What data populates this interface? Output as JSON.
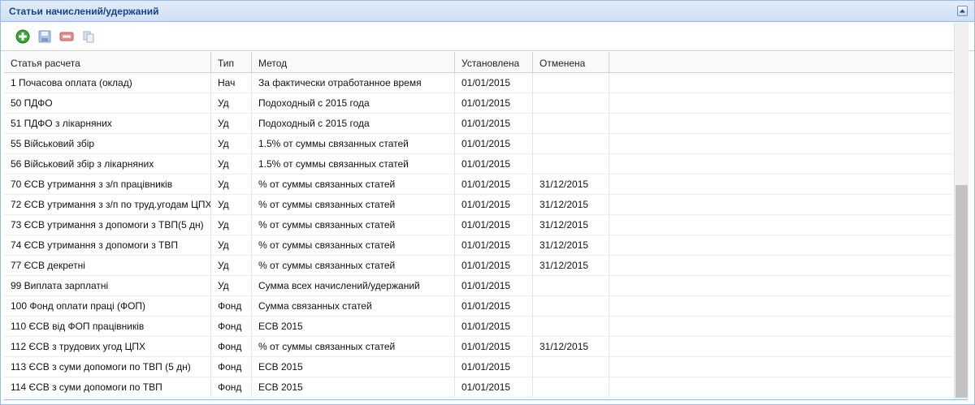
{
  "panel": {
    "title": "Статьи начислений/удержаний"
  },
  "toolbar": {
    "add_icon": "add-icon",
    "save_icon": "save-icon",
    "delete_icon": "delete-icon",
    "copy_icon": "copy-icon"
  },
  "grid": {
    "columns": [
      "Статья расчета",
      "Тип",
      "Метод",
      "Установлена",
      "Отменена"
    ],
    "rows": [
      [
        "1 Почасова оплата (оклад)",
        "Нач",
        "За фактически отработанное время",
        "01/01/2015",
        ""
      ],
      [
        "50 ПДФО",
        "Уд",
        "Подоходный с 2015 года",
        "01/01/2015",
        ""
      ],
      [
        "51 ПДФО з лікарняних",
        "Уд",
        "Подоходный с 2015 года",
        "01/01/2015",
        ""
      ],
      [
        "55 Військовий збір",
        "Уд",
        "1.5% от суммы связанных статей",
        "01/01/2015",
        ""
      ],
      [
        "56 Військовий збір з лікарняних",
        "Уд",
        "1.5% от суммы связанных статей",
        "01/01/2015",
        ""
      ],
      [
        "70 ЄСВ утримання з з/п працівників",
        "Уд",
        "% от суммы связанных статей",
        "01/01/2015",
        "31/12/2015"
      ],
      [
        "72 ЄСВ утримання з з/п по труд.угодам ЦПХ",
        "Уд",
        "% от суммы связанных статей",
        "01/01/2015",
        "31/12/2015"
      ],
      [
        "73 ЄСВ утримання з допомоги з ТВП(5 дн)",
        "Уд",
        "% от суммы связанных статей",
        "01/01/2015",
        "31/12/2015"
      ],
      [
        "74 ЄСВ утримання з допомоги з ТВП",
        "Уд",
        "% от суммы связанных статей",
        "01/01/2015",
        "31/12/2015"
      ],
      [
        "77 ЄСВ декретні",
        "Уд",
        "% от суммы связанных статей",
        "01/01/2015",
        "31/12/2015"
      ],
      [
        "99 Виплата зарплатні",
        "Уд",
        "Сумма всех начислений/удержаний",
        "01/01/2015",
        ""
      ],
      [
        "100 Фонд оплати праці (ФОП)",
        "Фонд",
        "Сумма связанных статей",
        "01/01/2015",
        ""
      ],
      [
        "110 ЄСВ від ФОП працівників",
        "Фонд",
        "ЕСВ 2015",
        "01/01/2015",
        ""
      ],
      [
        "112 ЄСВ з трудових угод ЦПХ",
        "Фонд",
        "% от суммы связанных статей",
        "01/01/2015",
        "31/12/2015"
      ],
      [
        "113 ЄСВ з суми допомоги по ТВП (5 дн)",
        "Фонд",
        "ЕСВ 2015",
        "01/01/2015",
        ""
      ],
      [
        "114 ЄСВ з суми допомоги по ТВП",
        "Фонд",
        "ЕСВ 2015",
        "01/01/2015",
        ""
      ]
    ]
  }
}
